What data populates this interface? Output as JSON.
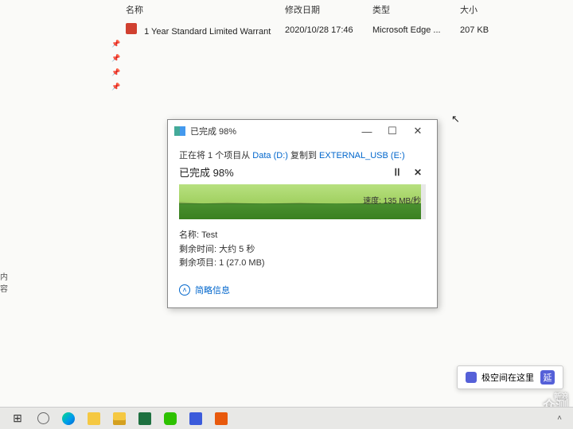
{
  "explorer": {
    "columns": {
      "name": "名称",
      "date": "修改日期",
      "type": "类型",
      "size": "大小"
    },
    "file": {
      "name": "1 Year Standard Limited Warrant",
      "date": "2020/10/28 17:46",
      "type": "Microsoft Edge ...",
      "size": "207 KB"
    }
  },
  "dialog": {
    "title": "已完成 98%",
    "copying_prefix": "正在将 1 个项目从 ",
    "src": "Data (D:)",
    "mid": " 复制到 ",
    "dst": "EXTERNAL_USB (E:)",
    "percent_label": "已完成 98%",
    "pause": "ⅠⅠ",
    "close": "✕",
    "speed": "速度: 135 MB/秒",
    "name_label": "名称: ",
    "name_value": "Test",
    "remaining_time": "剩余时间: 大约 5 秒",
    "remaining_items": "剩余项目: 1 (27.0 MB)",
    "less_info": "简略信息",
    "win_min": "—",
    "win_max": "☐",
    "win_close": "✕"
  },
  "notif": {
    "text": "极空间在这里",
    "close_hint": "延"
  },
  "watermark": {
    "top": "新浪",
    "main": "众测"
  },
  "left_edge": "内容",
  "taskbar": {
    "start": "⊞"
  }
}
